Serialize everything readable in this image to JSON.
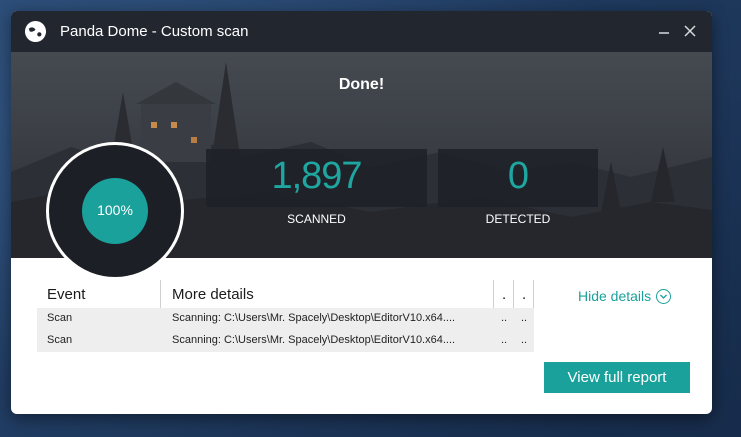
{
  "window": {
    "title": "Panda Dome - Custom scan",
    "minimize_icon": "minimize-icon",
    "close_icon": "close-icon"
  },
  "hero": {
    "status": "Done!",
    "progress_percent": 100,
    "progress_label": "100%",
    "scanned_value": "1,897",
    "scanned_label": "SCANNED",
    "detected_value": "0",
    "detected_label": "DETECTED"
  },
  "events_table": {
    "columns": [
      "Event",
      "More details",
      ".",
      "."
    ],
    "rows": [
      {
        "event": "Scan",
        "details": "Scanning: C:\\Users\\Mr. Spacely\\Desktop\\EditorV10.x64....",
        "c3": "..",
        "c4": ".."
      },
      {
        "event": "Scan",
        "details": "Scanning: C:\\Users\\Mr. Spacely\\Desktop\\EditorV10.x64....",
        "c3": "..",
        "c4": ".."
      }
    ]
  },
  "actions": {
    "hide_details": "Hide details",
    "view_report": "View full report"
  },
  "colors": {
    "accent": "#1ba19b",
    "titlebar": "#22272f"
  }
}
